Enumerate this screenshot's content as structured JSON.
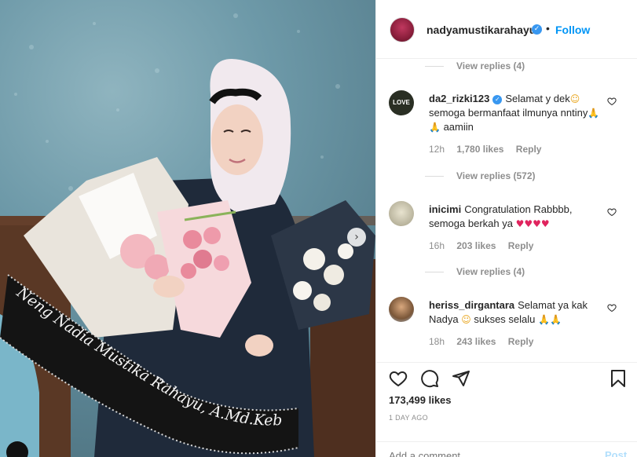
{
  "post": {
    "author": "nadyamustikarahayu",
    "follow_label": "Follow",
    "separator": "•",
    "likes": "173,499 likes",
    "time": "1 DAY AGO",
    "add_comment_placeholder": "Add a comment...",
    "post_label": "Post"
  },
  "photo": {
    "sash_text": "Neng Nadia Mustika Rahayu, A.Md.Keb"
  },
  "comments": [
    {
      "view_replies_above": "View replies (4)"
    },
    {
      "username": "da2_rizki123",
      "verified": true,
      "text": "Selamat y dek",
      "text2": "semoga bermanfaat ilmunya nntiny",
      "text3": "aamiin",
      "time": "12h",
      "likes": "1,780 likes",
      "reply": "Reply",
      "view_replies": "View replies (572)"
    },
    {
      "username": "inicimi",
      "text": "Congratulation Rabbbb, semoga berkah ya",
      "time": "16h",
      "likes": "203 likes",
      "reply": "Reply",
      "view_replies": "View replies (4)"
    },
    {
      "username": "heriss_dirgantara",
      "text": "Selamat ya kak Nadya",
      "text2": "sukses selalu",
      "time": "18h",
      "likes": "243 likes",
      "reply": "Reply"
    }
  ],
  "icons": {
    "like": "heart-icon",
    "comment": "comment-icon",
    "share": "share-icon",
    "save": "bookmark-icon",
    "verified": "verified-badge-icon"
  },
  "colors": {
    "link_blue": "#0095f6",
    "verified_blue": "#3897f0",
    "muted": "#8e8e8e",
    "post_disabled": "#b2dffc"
  }
}
